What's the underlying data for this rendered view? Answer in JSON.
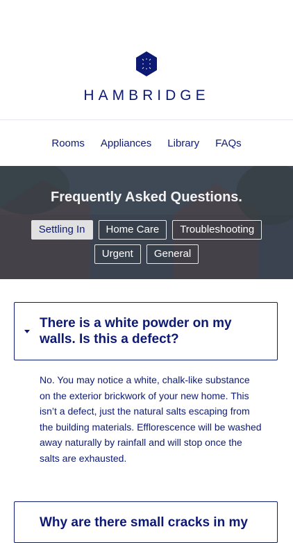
{
  "brand": {
    "name": "HAMBRIDGE",
    "logo_icon": "hexagon-logo-icon",
    "color": "#0d1a73"
  },
  "nav": {
    "items": [
      "Rooms",
      "Appliances",
      "Library",
      "FAQs"
    ]
  },
  "hero": {
    "title": "Frequently Asked Questions.",
    "filters": [
      "Settling In",
      "Home Care",
      "Troubleshooting",
      "Urgent",
      "General"
    ],
    "active_filter": "Settling In"
  },
  "faqs": [
    {
      "question": "There is a white powder on my walls. Is this a defect?",
      "answer": "No. You may notice a white, chalk-like substance on the exterior brickwork of your new home. This isn’t a defect, just the natural salts escaping from the building materials. Efflorescence will be washed away naturally by rainfall and will stop once the salts are exhausted.",
      "expanded": true,
      "icon": "caret-down-icon"
    },
    {
      "question": "Why are there small cracks in my",
      "expanded": false
    }
  ]
}
